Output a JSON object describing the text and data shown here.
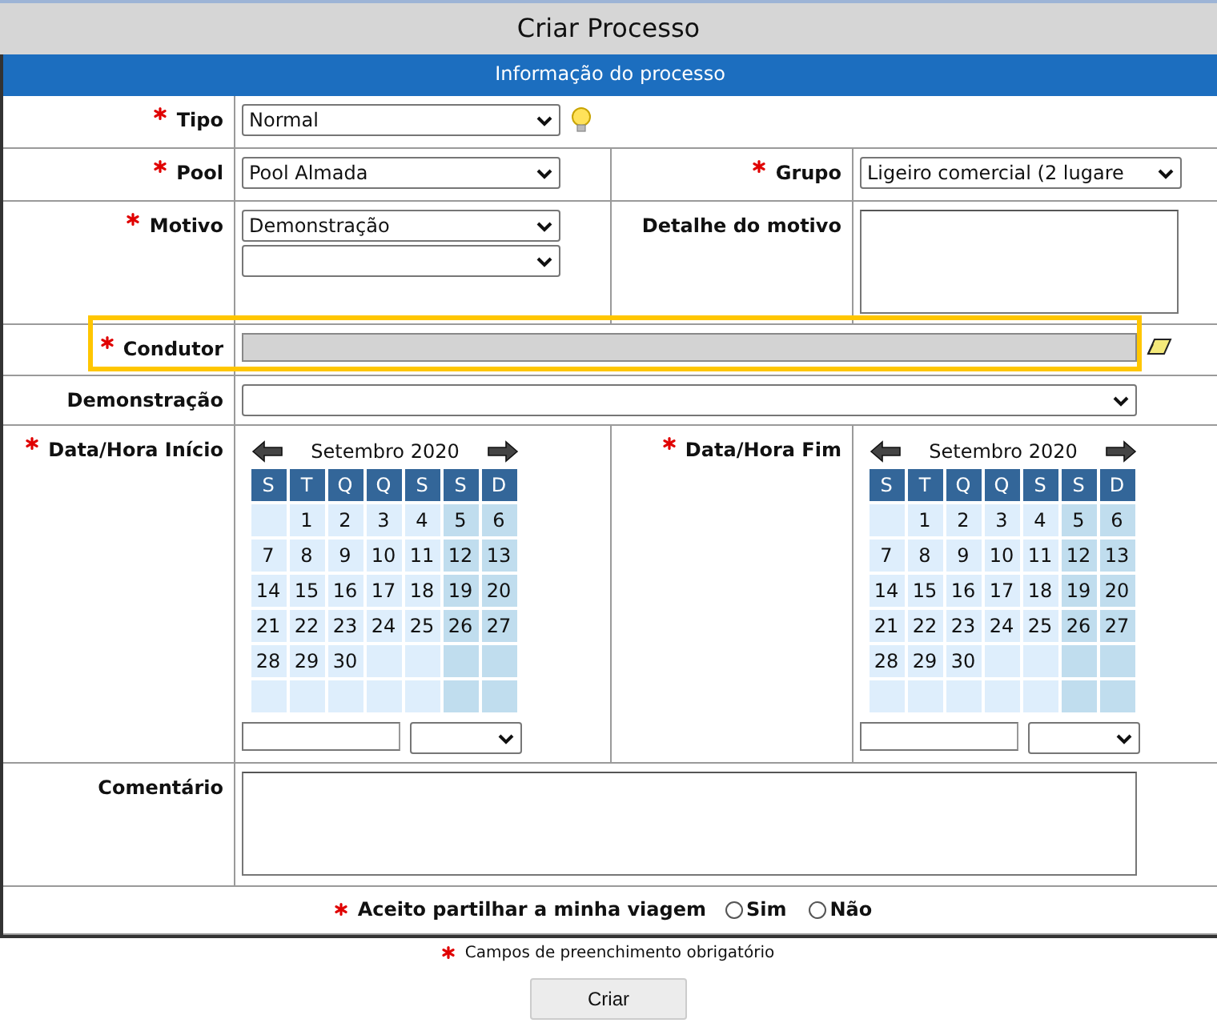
{
  "page_title": "Criar Processo",
  "section_title": "Informação do processo",
  "tipo": {
    "label": "Tipo",
    "required": true,
    "value": "Normal"
  },
  "pool": {
    "label": "Pool",
    "required": true,
    "value": "Pool Almada"
  },
  "grupo": {
    "label": "Grupo",
    "required": true,
    "value": "Ligeiro comercial (2 lugare"
  },
  "motivo": {
    "label": "Motivo",
    "required": true,
    "value": "Demonstração"
  },
  "detalhe": {
    "label": "Detalhe do motivo",
    "required": false
  },
  "condutor": {
    "label": "Condutor",
    "required": true,
    "disabled": true,
    "highlighted": true
  },
  "demonstracao": {
    "label": "Demonstração",
    "required": false
  },
  "inicio": {
    "label": "Data/Hora Início",
    "required": true,
    "calendar": {
      "month": "Setembro 2020",
      "weekdays": [
        "S",
        "T",
        "Q",
        "Q",
        "S",
        "S",
        "D"
      ],
      "weeks": [
        [
          {
            "kind": "blank"
          },
          {
            "kind": "day",
            "day": "1"
          },
          {
            "kind": "day",
            "day": "2"
          },
          {
            "kind": "day",
            "day": "3"
          },
          {
            "kind": "day",
            "day": "4"
          },
          {
            "kind": "day",
            "day": "5"
          },
          {
            "kind": "day",
            "day": "6"
          }
        ],
        [
          {
            "kind": "day",
            "day": "7"
          },
          {
            "kind": "day",
            "day": "8"
          },
          {
            "kind": "day",
            "day": "9"
          },
          {
            "kind": "day",
            "day": "10"
          },
          {
            "kind": "day",
            "day": "11"
          },
          {
            "kind": "day",
            "day": "12"
          },
          {
            "kind": "day",
            "day": "13"
          }
        ],
        [
          {
            "kind": "day",
            "day": "14"
          },
          {
            "kind": "day",
            "day": "15"
          },
          {
            "kind": "day",
            "day": "16"
          },
          {
            "kind": "day",
            "day": "17"
          },
          {
            "kind": "day",
            "day": "18"
          },
          {
            "kind": "day",
            "day": "19"
          },
          {
            "kind": "day",
            "day": "20"
          }
        ],
        [
          {
            "kind": "day",
            "day": "21"
          },
          {
            "kind": "day",
            "day": "22"
          },
          {
            "kind": "day",
            "day": "23"
          },
          {
            "kind": "day",
            "day": "24"
          },
          {
            "kind": "day",
            "day": "25"
          },
          {
            "kind": "day",
            "day": "26"
          },
          {
            "kind": "day",
            "day": "27"
          }
        ],
        [
          {
            "kind": "day",
            "day": "28"
          },
          {
            "kind": "day",
            "day": "29"
          },
          {
            "kind": "day",
            "day": "30"
          },
          {
            "kind": "blank"
          },
          {
            "kind": "blank"
          },
          {
            "kind": "blank"
          },
          {
            "kind": "blank"
          }
        ],
        [
          {
            "kind": "blank"
          },
          {
            "kind": "blank"
          },
          {
            "kind": "blank"
          },
          {
            "kind": "blank"
          },
          {
            "kind": "blank"
          },
          {
            "kind": "blank"
          },
          {
            "kind": "blank"
          }
        ]
      ]
    }
  },
  "fim": {
    "label": "Data/Hora Fim",
    "required": true,
    "calendar": {
      "month": "Setembro 2020",
      "weekdays": [
        "S",
        "T",
        "Q",
        "Q",
        "S",
        "S",
        "D"
      ],
      "weeks": [
        [
          {
            "kind": "blank"
          },
          {
            "kind": "day",
            "day": "1"
          },
          {
            "kind": "day",
            "day": "2"
          },
          {
            "kind": "day",
            "day": "3"
          },
          {
            "kind": "day",
            "day": "4"
          },
          {
            "kind": "day",
            "day": "5"
          },
          {
            "kind": "day",
            "day": "6"
          }
        ],
        [
          {
            "kind": "day",
            "day": "7"
          },
          {
            "kind": "day",
            "day": "8"
          },
          {
            "kind": "day",
            "day": "9"
          },
          {
            "kind": "day",
            "day": "10"
          },
          {
            "kind": "day",
            "day": "11"
          },
          {
            "kind": "day",
            "day": "12"
          },
          {
            "kind": "day",
            "day": "13"
          }
        ],
        [
          {
            "kind": "day",
            "day": "14"
          },
          {
            "kind": "day",
            "day": "15"
          },
          {
            "kind": "day",
            "day": "16"
          },
          {
            "kind": "day",
            "day": "17"
          },
          {
            "kind": "day",
            "day": "18"
          },
          {
            "kind": "day",
            "day": "19"
          },
          {
            "kind": "day",
            "day": "20"
          }
        ],
        [
          {
            "kind": "day",
            "day": "21"
          },
          {
            "kind": "day",
            "day": "22"
          },
          {
            "kind": "day",
            "day": "23"
          },
          {
            "kind": "day",
            "day": "24"
          },
          {
            "kind": "day",
            "day": "25"
          },
          {
            "kind": "day",
            "day": "26"
          },
          {
            "kind": "day",
            "day": "27"
          }
        ],
        [
          {
            "kind": "day",
            "day": "28"
          },
          {
            "kind": "day",
            "day": "29"
          },
          {
            "kind": "day",
            "day": "30"
          },
          {
            "kind": "blank"
          },
          {
            "kind": "blank"
          },
          {
            "kind": "blank"
          },
          {
            "kind": "blank"
          }
        ],
        [
          {
            "kind": "blank"
          },
          {
            "kind": "blank"
          },
          {
            "kind": "blank"
          },
          {
            "kind": "blank"
          },
          {
            "kind": "blank"
          },
          {
            "kind": "blank"
          },
          {
            "kind": "blank"
          }
        ]
      ]
    }
  },
  "comentario": {
    "label": "Comentário",
    "required": false
  },
  "partilha": {
    "label": "Aceito partilhar a minha viagem",
    "required": true,
    "options": [
      {
        "label": "Sim",
        "selected": false
      },
      {
        "label": "Não",
        "selected": false
      }
    ]
  },
  "legend": "Campos de preenchimento obrigatório",
  "submit": "Criar"
}
